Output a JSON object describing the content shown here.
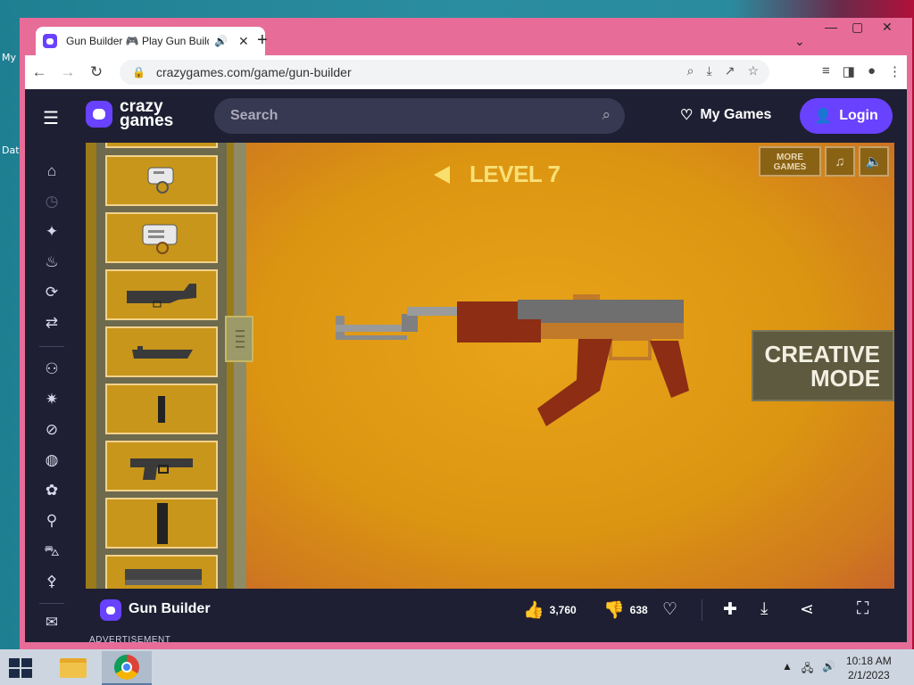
{
  "desktop": {
    "labels": [
      "My",
      "Dat"
    ]
  },
  "browser": {
    "tab_title": "Gun Builder 🎮 Play Gun Builder Online",
    "url": "crazygames.com/game/gun-builder"
  },
  "site": {
    "logo_line1": "crazy",
    "logo_line2": "games",
    "search_placeholder": "Search",
    "my_games": "My Games",
    "login": "Login"
  },
  "game": {
    "level": "LEVEL 7",
    "more_games_line1": "MORE",
    "more_games_line2": "GAMES",
    "creative_line1": "CREATIVE",
    "creative_line2": "MODE"
  },
  "footer": {
    "title": "Gun Builder",
    "likes": "3,760",
    "dislikes": "638",
    "advertisement": "ADVERTISEMENT"
  },
  "taskbar": {
    "time": "10:18 AM",
    "date": "2/1/2023"
  },
  "colors": {
    "accent": "#6842ff",
    "site_bg": "#1e1f33",
    "game_bg": "#e2a113",
    "frame": "#e76c98"
  }
}
